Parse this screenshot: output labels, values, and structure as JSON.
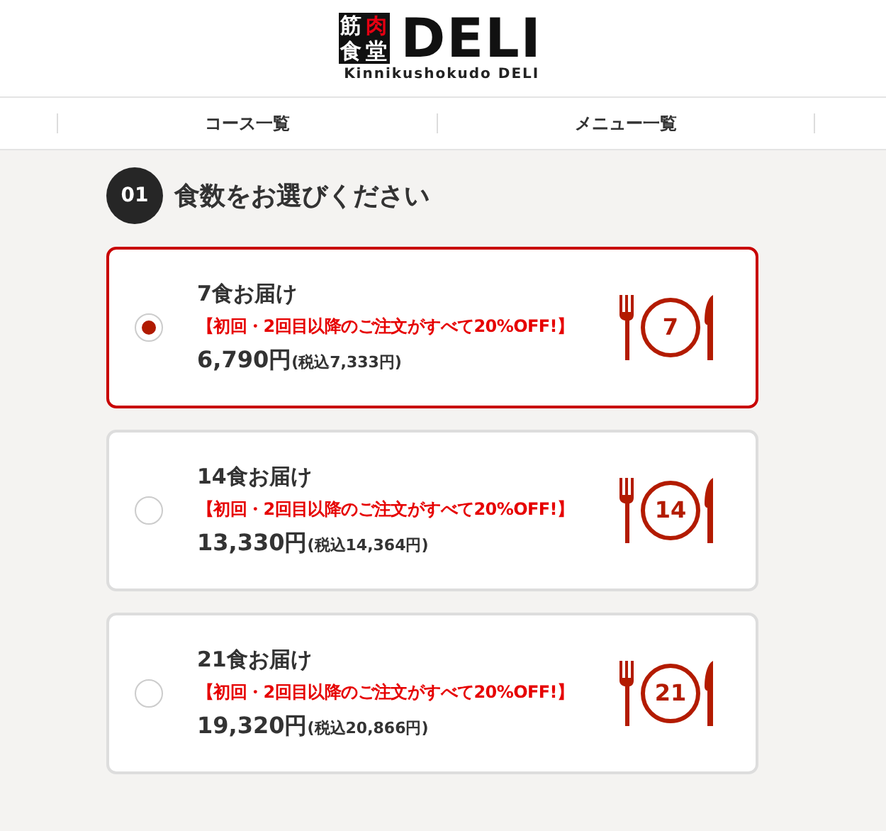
{
  "logo": {
    "chars": [
      {
        "text": "筋",
        "accent": false
      },
      {
        "text": "肉",
        "accent": true
      },
      {
        "text": "食",
        "accent": false
      },
      {
        "text": "堂",
        "accent": false
      }
    ],
    "wordmark": "DELI",
    "tagline": "Kinnikushokudo DELI"
  },
  "nav": [
    {
      "label": "コース一覧"
    },
    {
      "label": "メニュー一覧"
    }
  ],
  "step": {
    "number": "01",
    "title": "食数をお選びください"
  },
  "plans": [
    {
      "title": "7食お届け",
      "promo": "【初回・2回目以降のご注文がすべて20%OFF!】",
      "price": "6,790円",
      "tax_price": "(税込7,333円)",
      "count": "7",
      "selected": true
    },
    {
      "title": "14食お届け",
      "promo": "【初回・2回目以降のご注文がすべて20%OFF!】",
      "price": "13,330円",
      "tax_price": "(税込14,364円)",
      "count": "14",
      "selected": false
    },
    {
      "title": "21食お届け",
      "promo": "【初回・2回目以降のご注文がすべて20%OFF!】",
      "price": "19,320円",
      "tax_price": "(税込20,866円)",
      "count": "21",
      "selected": false
    }
  ]
}
